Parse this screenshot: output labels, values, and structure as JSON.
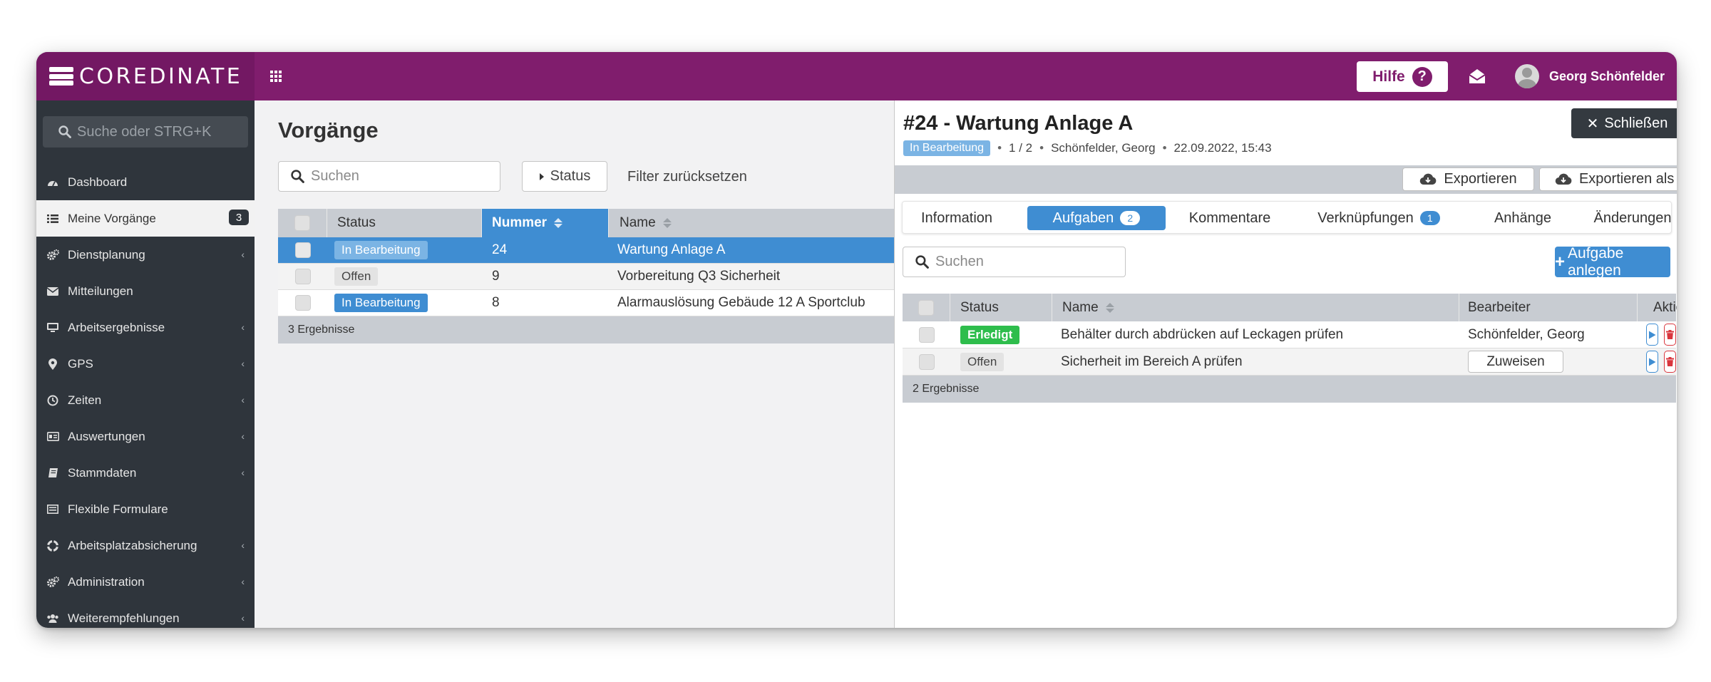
{
  "app": {
    "brand": "COREDINATE",
    "help_label": "Hilfe",
    "help_icon": "?",
    "user_name": "Georg Schönfelder"
  },
  "sidebar": {
    "search_placeholder": "Suche oder STRG+K",
    "items": [
      {
        "label": "Dashboard",
        "icon": "dashboard-icon",
        "chevron": false
      },
      {
        "label": "Meine Vorgänge",
        "icon": "list-icon",
        "badge": "3",
        "active": true
      },
      {
        "label": "Dienstplanung",
        "icon": "cogs-icon",
        "chevron": true
      },
      {
        "label": "Mitteilungen",
        "icon": "envelope-icon",
        "chevron": false
      },
      {
        "label": "Arbeitsergebnisse",
        "icon": "monitor-icon",
        "chevron": true
      },
      {
        "label": "GPS",
        "icon": "map-marker-icon",
        "chevron": true
      },
      {
        "label": "Zeiten",
        "icon": "clock-icon",
        "chevron": true
      },
      {
        "label": "Auswertungen",
        "icon": "chart-card-icon",
        "chevron": true
      },
      {
        "label": "Stammdaten",
        "icon": "book-icon",
        "chevron": true
      },
      {
        "label": "Flexible Formulare",
        "icon": "form-icon",
        "chevron": false
      },
      {
        "label": "Arbeitsplatzabsicherung",
        "icon": "lifebuoy-icon",
        "chevron": true
      },
      {
        "label": "Administration",
        "icon": "cogs-icon",
        "chevron": true
      },
      {
        "label": "Weiterempfehlungen",
        "icon": "users-icon",
        "chevron": true
      }
    ]
  },
  "list": {
    "title": "Vorgänge",
    "search_placeholder": "Suchen",
    "status_button": "Status",
    "filter_reset": "Filter zurücksetzen",
    "columns": {
      "status": "Status",
      "number": "Nummer",
      "name": "Name"
    },
    "rows": [
      {
        "status": "In Bearbeitung",
        "number": "24",
        "name": "Wartung Anlage A",
        "selected": true
      },
      {
        "status": "Offen",
        "number": "9",
        "name": "Vorbereitung Q3 Sicherheit"
      },
      {
        "status": "In Bearbeitung",
        "number": "8",
        "name": "Alarmauslösung Gebäude 12 A Sportclub"
      }
    ],
    "footer": "3 Ergebnisse"
  },
  "detail": {
    "title": "#24 - Wartung Anlage A",
    "status": "In Bearbeitung",
    "progress": "1 / 2",
    "assignee": "Schönfelder, Georg",
    "timestamp": "22.09.2022, 15:43",
    "close_label": "Schließen",
    "export_label": "Exportieren",
    "export_zip_label": "Exportieren als ZIP",
    "tabs": [
      {
        "label": "Information"
      },
      {
        "label": "Aufgaben",
        "count": "2",
        "active": true
      },
      {
        "label": "Kommentare"
      },
      {
        "label": "Verknüpfungen",
        "count": "1"
      },
      {
        "label": "Anhänge"
      },
      {
        "label": "Änderungen"
      }
    ],
    "search_placeholder": "Suchen",
    "add_task_label": "Aufgabe anlegen",
    "columns": {
      "status": "Status",
      "name": "Name",
      "assignee": "Bearbeiter",
      "action": "Aktion"
    },
    "tasks": [
      {
        "status": "Erledigt",
        "name": "Behälter durch abdrücken auf Leckagen prüfen",
        "assignee": "Schönfelder, Georg"
      },
      {
        "status": "Offen",
        "name": "Sicherheit im Bereich A prüfen",
        "assign_button": "Zuweisen"
      }
    ],
    "footer": "2 Ergebnisse"
  },
  "colors": {
    "topbar": "#801d6d",
    "sidebar": "#2f353c",
    "primary": "#3f8dd2",
    "success": "#2ebd4c",
    "danger": "#d9363e"
  }
}
